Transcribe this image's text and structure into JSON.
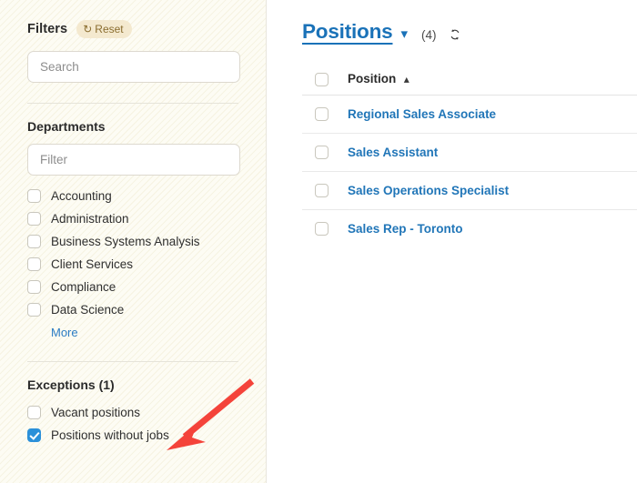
{
  "sidebar": {
    "filters": {
      "title": "Filters",
      "reset_label": "Reset",
      "reset_icon": "refresh-ccw-icon"
    },
    "search": {
      "placeholder": "Search",
      "value": ""
    },
    "departments": {
      "title": "Departments",
      "filter_placeholder": "Filter",
      "filter_value": "",
      "items": [
        {
          "label": "Accounting",
          "checked": false
        },
        {
          "label": "Administration",
          "checked": false
        },
        {
          "label": "Business Systems Analysis",
          "checked": false
        },
        {
          "label": "Client Services",
          "checked": false
        },
        {
          "label": "Compliance",
          "checked": false
        },
        {
          "label": "Data Science",
          "checked": false
        }
      ],
      "more_label": "More"
    },
    "exceptions": {
      "title": "Exceptions (1)",
      "items": [
        {
          "label": "Vacant positions",
          "checked": false
        },
        {
          "label": "Positions without jobs",
          "checked": true
        }
      ]
    }
  },
  "main": {
    "title": "Positions",
    "title_chevron": "chevron-down-icon",
    "count": "(4)",
    "refresh_icon": "refresh-icon",
    "table": {
      "columns": [
        {
          "label": "Position",
          "sort": "ascending",
          "sort_icon": "chevron-up-icon"
        }
      ],
      "rows": [
        {
          "position": "Regional Sales Associate",
          "checked": false
        },
        {
          "position": "Sales Assistant",
          "checked": false
        },
        {
          "position": "Sales Operations Specialist",
          "checked": false
        },
        {
          "position": "Sales Rep - Toronto",
          "checked": false
        }
      ]
    }
  },
  "annotation": {
    "type": "arrow",
    "color": "#f4433a",
    "points_to": "positions-without-jobs-checkbox"
  },
  "colors": {
    "link_blue": "#2176b8",
    "title_blue": "#1a72b8",
    "checkbox_checked": "#2b90d9",
    "reset_badge_bg": "#f4e9cf",
    "reset_badge_fg": "#8a6d2f",
    "sidebar_bg": "#fdfcf4",
    "annotation_red": "#f4433a"
  }
}
